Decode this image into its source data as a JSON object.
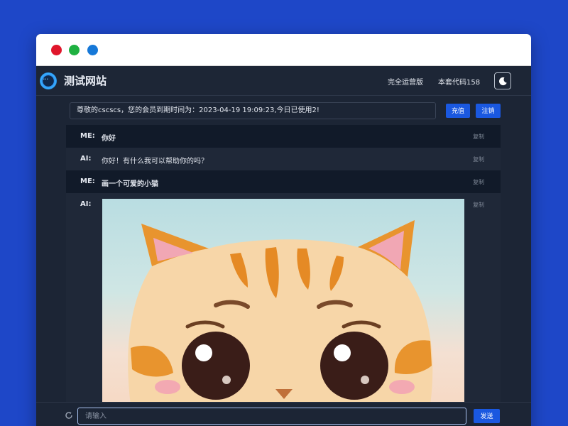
{
  "window": {
    "controls": [
      "close-dot",
      "minimize-dot",
      "zoom-dot"
    ]
  },
  "header": {
    "site_title": "测试网站",
    "nav": [
      "完全运营版",
      "本套代码158"
    ],
    "theme_toggle_icon": "moon-icon"
  },
  "notice": {
    "text": "尊敬的cscscs，您的会员到期时间为：2023-04-19 19:09:23,今日已使用2!",
    "recharge_label": "充值",
    "logout_label": "注销"
  },
  "messages": [
    {
      "role": "ME:",
      "text": "你好",
      "copy_label": "复制"
    },
    {
      "role": "AI:",
      "text": "你好！有什么我可以帮助你的吗？",
      "copy_label": "复制"
    },
    {
      "role": "ME:",
      "text": "画一个可爱的小猫",
      "copy_label": "复制"
    },
    {
      "role": "AI:",
      "image": "cat-illustration",
      "copy_label": "复制"
    }
  ],
  "composer": {
    "placeholder": "请输入",
    "send_label": "发送",
    "refresh_icon": "refresh-icon"
  },
  "colors": {
    "page_background": "#1e47c8",
    "app_background": "#1c2535",
    "accent": "#1a58e0",
    "window_dots": [
      "#e0162b",
      "#1fb141",
      "#1678d8"
    ]
  }
}
